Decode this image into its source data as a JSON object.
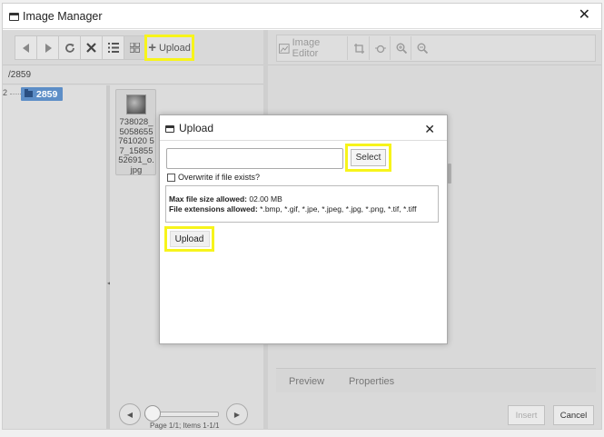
{
  "window": {
    "title": "Image Manager",
    "close_glyph": "✕"
  },
  "left_toolbar": {
    "upload_label": "Upload",
    "icons": [
      "back-icon",
      "forward-icon",
      "refresh-icon",
      "delete-icon",
      "list-view-icon",
      "grid-view-icon"
    ]
  },
  "path": {
    "text": "/2859"
  },
  "tree": {
    "folder_label": "2859"
  },
  "files": [
    {
      "name": "738028_5058655761020 57_1585552691_o.jpg"
    }
  ],
  "pager": {
    "text": "Page 1/1; Items 1-1/1"
  },
  "right_toolbar": {
    "image_editor_label": "Image Editor"
  },
  "right_tabs": {
    "preview": "Preview",
    "properties": "Properties"
  },
  "footer": {
    "insert": "Insert",
    "cancel": "Cancel"
  },
  "upload_dialog": {
    "title": "Upload",
    "close_glyph": "✕",
    "file_input_value": "",
    "select_label": "Select",
    "overwrite_label": "Overwrite if file exists?",
    "overwrite_checked": false,
    "max_size_label": "Max file size allowed:",
    "max_size_value": "02.00 MB",
    "extensions_label": "File extensions allowed:",
    "extensions_value": "*.bmp, *.gif, *.jpe, *.jpeg, *.jpg, *.png, *.tif, *.tiff",
    "upload_label": "Upload"
  },
  "colors": {
    "highlight": "#f7f41b",
    "tree_selected": "#5d8ec7"
  }
}
